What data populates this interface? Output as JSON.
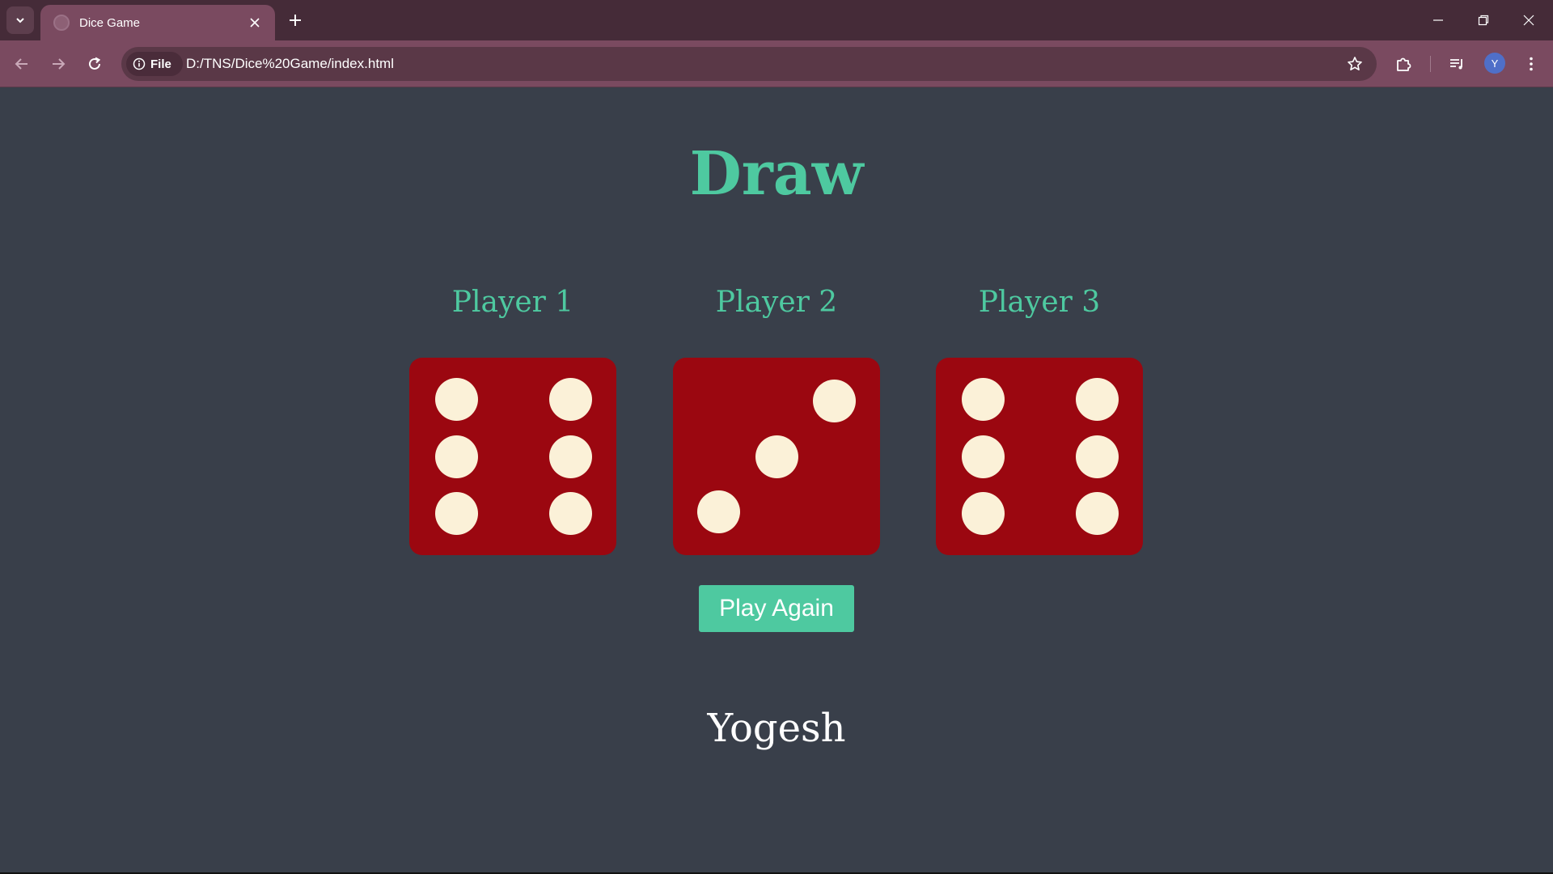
{
  "browser": {
    "tab_title": "Dice Game",
    "site_info_label": "File",
    "url": "D:/TNS/Dice%20Game/index.html",
    "profile_initial": "Y"
  },
  "page": {
    "heading": "Draw",
    "players": [
      {
        "label": "Player 1",
        "die_value": 6
      },
      {
        "label": "Player 2",
        "die_value": 3
      },
      {
        "label": "Player 3",
        "die_value": 6
      }
    ],
    "play_again_label": "Play Again",
    "footer_name": "Yogesh"
  },
  "colors": {
    "page_background": "#393f4a",
    "accent": "#4ec9a0",
    "die_face": "#9b0710",
    "pip": "#fbf1d8"
  }
}
